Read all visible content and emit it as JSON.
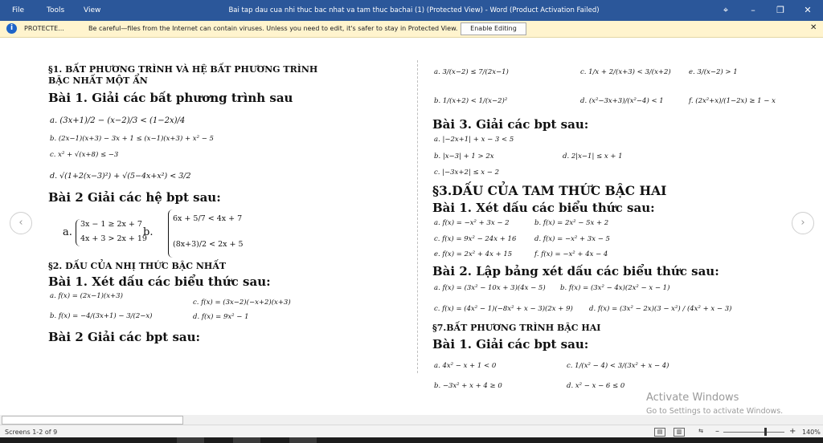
{
  "titlebar": {
    "menu": [
      "File",
      "Tools",
      "View"
    ],
    "title": "Bai tap dau cua nhi thuc bac nhat va tam thuc bachai (1) (Protected View) - Word (Product Activation Failed)",
    "controls": {
      "fit": "⌖",
      "minimize": "–",
      "restore": "❐",
      "close": "✕"
    }
  },
  "protected_bar": {
    "label": "PROTECTE...",
    "message": "Be careful—files from the Internet can contain viruses. Unless you need to edit, it's safer to stay in Protected View.",
    "button": "Enable Editing",
    "close": "✕"
  },
  "document": {
    "left": {
      "s1_title_1": "§1. BẤT PHƯƠNG TRÌNH VÀ HỆ BẤT PHƯƠNG TRÌNH",
      "s1_title_2": "BẬC NHẤT MỘT ẨN",
      "bai1": "Bài 1. Giải các bất phương trình sau",
      "b1_a": "a.  (3x+1)/2 − (x−2)/3 < (1−2x)/4",
      "b1_b": "b.  (2x−1)(x+3) − 3x + 1 ≤ (x−1)(x+3) + x² − 5",
      "b1_c": "c.  x² + √(x+8) ≤ −3",
      "b1_d": "d.  √(1+2(x−3)²) + √(5−4x+x²) < 3/2",
      "bai2": "Bài 2 Giải các hệ bpt sau:",
      "b2_a_label": "a.",
      "b2_a1": "3x − 1 ≥ 2x + 7",
      "b2_a2": "4x + 3 > 2x + 19",
      "b2_b_label": "b.",
      "b2_b1": "6x + 5/7 < 4x + 7",
      "b2_b2": "(8x+3)/2 < 2x + 5",
      "s2_title": "§2. DẤU CỦA NHỊ THỨC BẬC NHẤT",
      "s2_bai1": "Bài 1. Xét dấu các biểu thức sau:",
      "s2_a": "a. f(x) = (2x−1)(x+3)",
      "s2_b": "b. f(x) = −4/(3x+1) − 3/(2−x)",
      "s2_c": "c. f(x) = (3x−2)(−x+2)(x+3)",
      "s2_d": "d. f(x) = 9x² − 1",
      "s2_bai2": "Bài 2 Giải các bpt sau:"
    },
    "right": {
      "r_a": "a.  3/(x−2) ≤ 7/(2x−1)",
      "r_c": "c.  1/x + 2/(x+3) < 3/(x+2)",
      "r_e": "e.  3/(x−2) > 1",
      "r_b": "b.  1/(x+2) < 1/(x−2)²",
      "r_d": "d.  (x²−3x+3)/(x²−4) < 1",
      "r_f": "f.  (2x²+x)/(1−2x) ≥ 1 − x",
      "bai3": "Bài 3. Giải các bpt sau:",
      "b3_a": "a. |−2x+1| + x − 3 < 5",
      "b3_b": "b. |x−3| + 1 > 2x",
      "b3_d": "d. 2|x−1| ≤ x + 1",
      "b3_c": "c. |−3x+2| ≤ x − 2",
      "s3_title": "§3.DẤU CỦA TAM THỨC BẬC HAI",
      "s3_bai1": "Bài 1. Xét dấu các biểu thức sau:",
      "s3_a": "a. f(x) = −x² + 3x − 2",
      "s3_b": "b. f(x) = 2x² − 5x + 2",
      "s3_c": "c. f(x) = 9x² − 24x + 16",
      "s3_d": "d. f(x) = −x² + 3x − 5",
      "s3_e": "e. f(x) = 2x² + 4x + 15",
      "s3_f": "f. f(x) = −x² + 4x − 4",
      "s3_bai2": "Bài 2. Lập bảng xét dấu các biểu thức sau:",
      "s3b2_a": "a. f(x) = (3x² − 10x + 3)(4x − 5)",
      "s3b2_b": "b. f(x) = (3x² − 4x)(2x² − x − 1)",
      "s3b2_c": "c. f(x) = (4x² − 1)(−8x² + x − 3)(2x + 9)",
      "s3b2_d": "d. f(x) = (3x² − 2x)(3 − x²) / (4x² + x − 3)",
      "s7_title": "§7.BẤT PHƯƠNG TRÌNH BẬC HAI",
      "s7_bai1": "Bài 1. Giải các bpt sau:",
      "s7_a": "a. 4x² − x + 1 < 0",
      "s7_c": "c.  1/(x² − 4) < 3/(3x² + x − 4)",
      "s7_b": "b. −3x² + x + 4 ≥ 0",
      "s7_d": "d. x² − x − 6 ≤ 0"
    }
  },
  "nav": {
    "prev": "‹",
    "next": "›"
  },
  "watermark": {
    "line1": "Activate Windows",
    "line2": "Go to Settings to activate Windows."
  },
  "statusbar": {
    "pages": "Screens 1-2 of 9",
    "zoom_minus": "–",
    "zoom_plus": "+",
    "zoom": "140%",
    "zoom_level_pct": 140
  }
}
